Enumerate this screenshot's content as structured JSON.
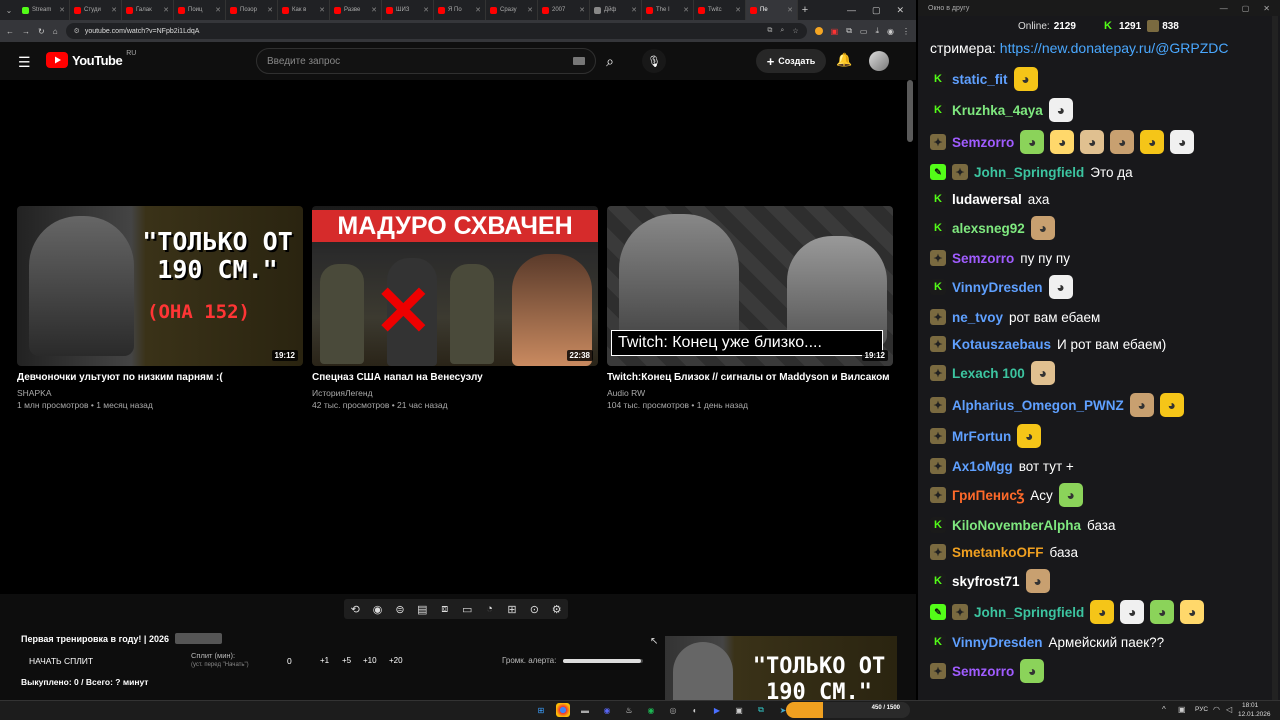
{
  "browser": {
    "tabs": [
      {
        "label": "Stream",
        "color": "#53fc18"
      },
      {
        "label": "Студи",
        "color": "#ff0000"
      },
      {
        "label": "Галак",
        "color": "#ff0000"
      },
      {
        "label": "Поиц",
        "color": "#ff0000"
      },
      {
        "label": "Позор",
        "color": "#ff0000"
      },
      {
        "label": "Как в",
        "color": "#ff0000"
      },
      {
        "label": "Разве",
        "color": "#ff0000"
      },
      {
        "label": "ШИЗ",
        "color": "#ff0000"
      },
      {
        "label": "Я По",
        "color": "#ff0000"
      },
      {
        "label": "Сразу",
        "color": "#ff0000"
      },
      {
        "label": "2007",
        "color": "#ff0000"
      },
      {
        "label": "Дйф",
        "color": "#888888"
      },
      {
        "label": "The I",
        "color": "#ff0000"
      },
      {
        "label": "Twitc",
        "color": "#ff0000"
      },
      {
        "label": "Пе",
        "color": "#ff0000"
      }
    ],
    "url": "youtube.com/watch?v=NFpb2i1LdqA"
  },
  "youtube": {
    "logo": "YouTube",
    "region": "RU",
    "search_placeholder": "Введите запрос",
    "create_label": "Создать"
  },
  "videos": [
    {
      "thumb_text": "\"ТОЛЬКО ОТ 190 СМ.\"",
      "thumb_sub": "(ОНА 152)",
      "duration": "19:12",
      "title": "Девчоночки ультуют по низким парням :(",
      "channel": "SHAPKA",
      "meta": "1 млн просмотров • 1 месяц назад"
    },
    {
      "thumb_text": "МАДУРО СХВАЧЕН",
      "thumb_sub": "",
      "duration": "22:38",
      "title": "Спецназ США напал на Венесуэлу",
      "channel": "ИсторияЛегенд",
      "meta": "42 тыс. просмотров • 21 час назад"
    },
    {
      "thumb_text": "Twitch: Конец уже близко....",
      "thumb_sub": "",
      "duration": "19:12",
      "title": "Twitch:Конец Близок // сигналы от Maddyson и Вилсаком",
      "channel": "Audio RW",
      "meta": "104 тыс. просмотров • 1 день назад"
    }
  ],
  "panel": {
    "title": "Первая тренировка в году! | 2026",
    "title_tag": "",
    "start_split": "НАЧАТЬ СПЛИТ",
    "split_label": "Сплит (мин):",
    "split_hint": "(уст. перед \"Начать\")",
    "split_value": "0",
    "increments": [
      "+1",
      "+5",
      "+10",
      "+20"
    ],
    "alert_label": "Громк. алерта:",
    "alert_volume_fraction": 0.98,
    "done": "Выкуплено: 0 / Всего: ? минут",
    "preview_text": "\"ТОЛЬКО ОТ 190 СМ.\""
  },
  "taskbar": {
    "progress": "450 / 1500",
    "lang": "РУС",
    "time": "18:01",
    "date": "12.01.2026"
  },
  "chat": {
    "window_title": "Окно в другу",
    "online_label": "Online:",
    "online_value": "2129",
    "count_a": "1291",
    "count_b": "838",
    "top_text": "стримера:",
    "top_link": "https://new.donatepay.ru/@GRPZDC",
    "messages": [
      {
        "badges": [
          "k"
        ],
        "nick": "static_fit",
        "color": "#5fa0ff",
        "text": "",
        "emotes": 1
      },
      {
        "badges": [
          "k"
        ],
        "nick": "Kruzhka_4aya",
        "color": "#7fe87f",
        "text": "",
        "emotes": 1
      },
      {
        "badges": [
          "sub"
        ],
        "nick": "Semzorro",
        "color": "#a05cff",
        "text": "",
        "emotes": 6
      },
      {
        "badges": [
          "mod",
          "sub"
        ],
        "nick": "John_Springfield",
        "color": "#3cc4a0",
        "text": "Это да",
        "emotes": 0
      },
      {
        "badges": [
          "k"
        ],
        "nick": "ludawersal",
        "color": "#ffffff",
        "text": "аха",
        "emotes": 0
      },
      {
        "badges": [
          "k"
        ],
        "nick": "alexsneg92",
        "color": "#7fe87f",
        "text": "",
        "emotes": 1
      },
      {
        "badges": [
          "sub"
        ],
        "nick": "Semzorro",
        "color": "#a05cff",
        "text": "пу пу пу",
        "emotes": 0
      },
      {
        "badges": [
          "k"
        ],
        "nick": "VinnyDresden",
        "color": "#5fa0ff",
        "text": "",
        "emotes": 1
      },
      {
        "badges": [
          "sub"
        ],
        "nick": "ne_tvoy",
        "color": "#5fa0ff",
        "text": "рот вам ебаем",
        "emotes": 0
      },
      {
        "badges": [
          "sub"
        ],
        "nick": "Kotauszaebaus",
        "color": "#5fa0ff",
        "text": "И рот вам ебаем)",
        "emotes": 0
      },
      {
        "badges": [
          "sub"
        ],
        "nick": "Lexach 100",
        "color": "#3cc4a0",
        "text": "",
        "emotes": 1
      },
      {
        "badges": [
          "sub"
        ],
        "nick": "Alpharius_Omegon_PWNZ",
        "color": "#5fa0ff",
        "text": "",
        "emotes": 2
      },
      {
        "badges": [
          "sub"
        ],
        "nick": "MrFortun",
        "color": "#5fa0ff",
        "text": "",
        "emotes": 1
      },
      {
        "badges": [
          "sub"
        ],
        "nick": "Ax1oMgg",
        "color": "#5fa0ff",
        "text": "вот тут +",
        "emotes": 0
      },
      {
        "badges": [
          "sub"
        ],
        "nick": "ГриПенисꝢ",
        "color": "#ff6a2a",
        "text": "Асу",
        "emotes": 1
      },
      {
        "badges": [
          "k"
        ],
        "nick": "KiloNovemberAlpha",
        "color": "#7fe87f",
        "text": "база",
        "emotes": 0
      },
      {
        "badges": [
          "sub"
        ],
        "nick": "SmetankoOFF",
        "color": "#f0a020",
        "text": "база",
        "emotes": 0
      },
      {
        "badges": [
          "k"
        ],
        "nick": "skyfrost71",
        "color": "#ffffff",
        "text": "",
        "emotes": 1
      },
      {
        "badges": [
          "mod",
          "sub"
        ],
        "nick": "John_Springfield",
        "color": "#3cc4a0",
        "text": "",
        "emotes": 4
      },
      {
        "badges": [
          "k"
        ],
        "nick": "VinnyDresden",
        "color": "#5fa0ff",
        "text": "Армейский паек??",
        "emotes": 0
      },
      {
        "badges": [
          "sub"
        ],
        "nick": "Semzorro",
        "color": "#a05cff",
        "text": "",
        "emotes": 1
      }
    ]
  }
}
